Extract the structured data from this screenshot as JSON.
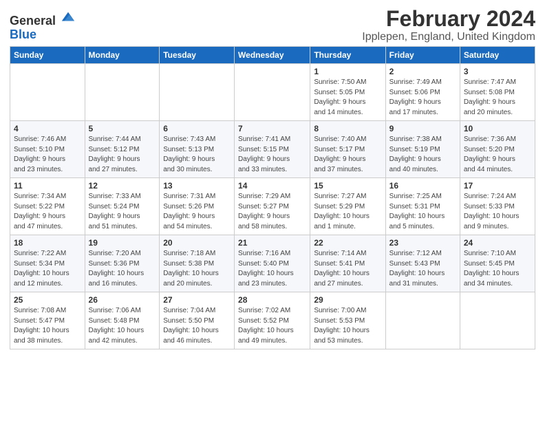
{
  "header": {
    "logo_general": "General",
    "logo_blue": "Blue",
    "title": "February 2024",
    "subtitle": "Ipplepen, England, United Kingdom"
  },
  "calendar": {
    "days_of_week": [
      "Sunday",
      "Monday",
      "Tuesday",
      "Wednesday",
      "Thursday",
      "Friday",
      "Saturday"
    ],
    "weeks": [
      [
        {
          "day": "",
          "info": ""
        },
        {
          "day": "",
          "info": ""
        },
        {
          "day": "",
          "info": ""
        },
        {
          "day": "",
          "info": ""
        },
        {
          "day": "1",
          "info": "Sunrise: 7:50 AM\nSunset: 5:05 PM\nDaylight: 9 hours\nand 14 minutes."
        },
        {
          "day": "2",
          "info": "Sunrise: 7:49 AM\nSunset: 5:06 PM\nDaylight: 9 hours\nand 17 minutes."
        },
        {
          "day": "3",
          "info": "Sunrise: 7:47 AM\nSunset: 5:08 PM\nDaylight: 9 hours\nand 20 minutes."
        }
      ],
      [
        {
          "day": "4",
          "info": "Sunrise: 7:46 AM\nSunset: 5:10 PM\nDaylight: 9 hours\nand 23 minutes."
        },
        {
          "day": "5",
          "info": "Sunrise: 7:44 AM\nSunset: 5:12 PM\nDaylight: 9 hours\nand 27 minutes."
        },
        {
          "day": "6",
          "info": "Sunrise: 7:43 AM\nSunset: 5:13 PM\nDaylight: 9 hours\nand 30 minutes."
        },
        {
          "day": "7",
          "info": "Sunrise: 7:41 AM\nSunset: 5:15 PM\nDaylight: 9 hours\nand 33 minutes."
        },
        {
          "day": "8",
          "info": "Sunrise: 7:40 AM\nSunset: 5:17 PM\nDaylight: 9 hours\nand 37 minutes."
        },
        {
          "day": "9",
          "info": "Sunrise: 7:38 AM\nSunset: 5:19 PM\nDaylight: 9 hours\nand 40 minutes."
        },
        {
          "day": "10",
          "info": "Sunrise: 7:36 AM\nSunset: 5:20 PM\nDaylight: 9 hours\nand 44 minutes."
        }
      ],
      [
        {
          "day": "11",
          "info": "Sunrise: 7:34 AM\nSunset: 5:22 PM\nDaylight: 9 hours\nand 47 minutes."
        },
        {
          "day": "12",
          "info": "Sunrise: 7:33 AM\nSunset: 5:24 PM\nDaylight: 9 hours\nand 51 minutes."
        },
        {
          "day": "13",
          "info": "Sunrise: 7:31 AM\nSunset: 5:26 PM\nDaylight: 9 hours\nand 54 minutes."
        },
        {
          "day": "14",
          "info": "Sunrise: 7:29 AM\nSunset: 5:27 PM\nDaylight: 9 hours\nand 58 minutes."
        },
        {
          "day": "15",
          "info": "Sunrise: 7:27 AM\nSunset: 5:29 PM\nDaylight: 10 hours\nand 1 minute."
        },
        {
          "day": "16",
          "info": "Sunrise: 7:25 AM\nSunset: 5:31 PM\nDaylight: 10 hours\nand 5 minutes."
        },
        {
          "day": "17",
          "info": "Sunrise: 7:24 AM\nSunset: 5:33 PM\nDaylight: 10 hours\nand 9 minutes."
        }
      ],
      [
        {
          "day": "18",
          "info": "Sunrise: 7:22 AM\nSunset: 5:34 PM\nDaylight: 10 hours\nand 12 minutes."
        },
        {
          "day": "19",
          "info": "Sunrise: 7:20 AM\nSunset: 5:36 PM\nDaylight: 10 hours\nand 16 minutes."
        },
        {
          "day": "20",
          "info": "Sunrise: 7:18 AM\nSunset: 5:38 PM\nDaylight: 10 hours\nand 20 minutes."
        },
        {
          "day": "21",
          "info": "Sunrise: 7:16 AM\nSunset: 5:40 PM\nDaylight: 10 hours\nand 23 minutes."
        },
        {
          "day": "22",
          "info": "Sunrise: 7:14 AM\nSunset: 5:41 PM\nDaylight: 10 hours\nand 27 minutes."
        },
        {
          "day": "23",
          "info": "Sunrise: 7:12 AM\nSunset: 5:43 PM\nDaylight: 10 hours\nand 31 minutes."
        },
        {
          "day": "24",
          "info": "Sunrise: 7:10 AM\nSunset: 5:45 PM\nDaylight: 10 hours\nand 34 minutes."
        }
      ],
      [
        {
          "day": "25",
          "info": "Sunrise: 7:08 AM\nSunset: 5:47 PM\nDaylight: 10 hours\nand 38 minutes."
        },
        {
          "day": "26",
          "info": "Sunrise: 7:06 AM\nSunset: 5:48 PM\nDaylight: 10 hours\nand 42 minutes."
        },
        {
          "day": "27",
          "info": "Sunrise: 7:04 AM\nSunset: 5:50 PM\nDaylight: 10 hours\nand 46 minutes."
        },
        {
          "day": "28",
          "info": "Sunrise: 7:02 AM\nSunset: 5:52 PM\nDaylight: 10 hours\nand 49 minutes."
        },
        {
          "day": "29",
          "info": "Sunrise: 7:00 AM\nSunset: 5:53 PM\nDaylight: 10 hours\nand 53 minutes."
        },
        {
          "day": "",
          "info": ""
        },
        {
          "day": "",
          "info": ""
        }
      ]
    ]
  }
}
